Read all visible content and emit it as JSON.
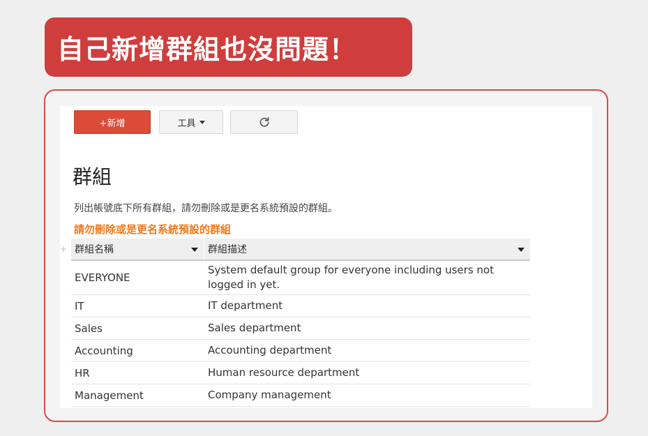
{
  "banner": {
    "text": "自己新增群組也沒問題！"
  },
  "toolbar": {
    "add_label": "+新增",
    "tools_label": "工具",
    "refresh_icon": "refresh-icon"
  },
  "page": {
    "title": "群組",
    "description": "列出帳號底下所有群組，請勿刪除或是更名系統預設的群組。",
    "warning": "請勿刪除或是更名系統預設的群組",
    "expand_glyph": "+"
  },
  "table": {
    "headers": [
      "群組名稱",
      "群組描述"
    ],
    "rows": [
      {
        "name": "EVERYONE",
        "description": "System default group for everyone including users not logged in yet."
      },
      {
        "name": "IT",
        "description": "IT department"
      },
      {
        "name": "Sales",
        "description": "Sales department"
      },
      {
        "name": "Accounting",
        "description": "Accounting department"
      },
      {
        "name": "HR",
        "description": "Human resource department"
      },
      {
        "name": "Management",
        "description": "Company management"
      }
    ]
  },
  "colors": {
    "banner": "#d03d3d",
    "add_button": "#dc4a38",
    "warning": "#f07a1a",
    "frame_border": "#d84a4a"
  }
}
